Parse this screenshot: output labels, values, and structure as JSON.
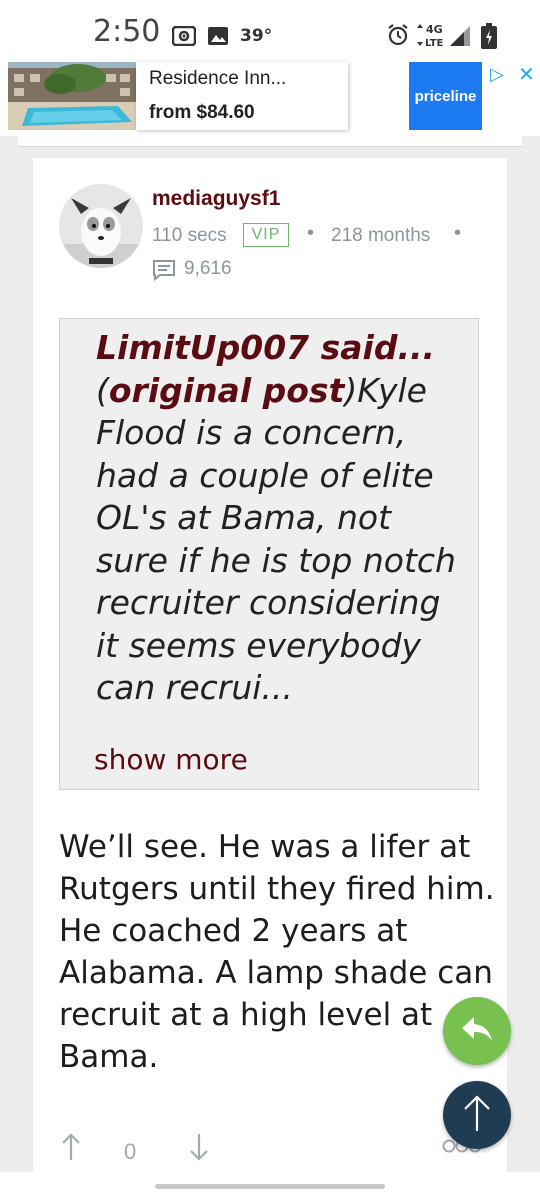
{
  "status_bar": {
    "time": "2:50",
    "temperature": "39°",
    "network": "4G LTE",
    "icons": [
      "cast-icon",
      "image-icon",
      "alarm-icon",
      "signal-icon",
      "battery-icon"
    ]
  },
  "ad": {
    "title": "Residence Inn...",
    "price": "from $84.60",
    "brand": "priceline",
    "brand_color": "#1d7bf2"
  },
  "post": {
    "username": "mediaguysf1",
    "time_ago": "110 secs",
    "badge": "VIP",
    "membership": "218 months",
    "post_count": "9,616",
    "quote": {
      "author": "LimitUp007 said...",
      "original_link": "original post",
      "text_line1_tail": "Kyle",
      "text_rest": "Flood is a concern, had a couple of elite OL's at Bama, not sure if he is top notch recruiter considering it seems everybody can recrui...",
      "show_more": "show more"
    },
    "body": "We’ll see. He was a lifer at Rutgers until they fired him. He coached 2 years at Alabama. A lamp shade can recruit at a high level at Bama.",
    "vote_count": "0"
  },
  "colors": {
    "accent_maroon": "#5a0c12",
    "vip_green": "#6cb86c",
    "reply_fab": "#78c04f",
    "top_fab": "#1f3c52",
    "meta_gray": "#8a96a0"
  }
}
